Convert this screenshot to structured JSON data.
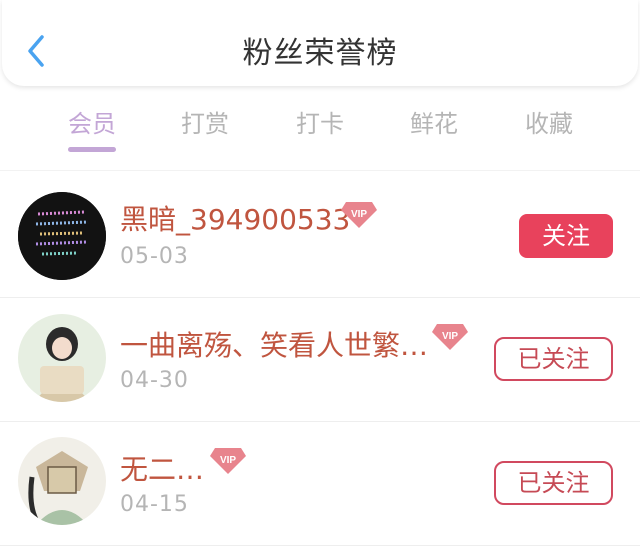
{
  "header": {
    "title": "粉丝荣誉榜",
    "back_icon": "chevron-left-icon"
  },
  "tabs": [
    {
      "label": "会员",
      "active": true
    },
    {
      "label": "打赏",
      "active": false
    },
    {
      "label": "打卡",
      "active": false
    },
    {
      "label": "鲜花",
      "active": false
    },
    {
      "label": "收藏",
      "active": false
    }
  ],
  "colors": {
    "active_tab": "#c3a6d6",
    "name": "#c0553f",
    "follow_button": "#e8425c",
    "followed_border": "#d1495f"
  },
  "fans": [
    {
      "name": "黑暗_394900533",
      "vip": "VIP",
      "date": "05-03",
      "button": "关注",
      "followed": false
    },
    {
      "name": "一曲离殇、笑看人世繁…",
      "vip": "VIP",
      "date": "04-30",
      "button": "已关注",
      "followed": true
    },
    {
      "name": "无二…",
      "vip": "VIP",
      "date": "04-15",
      "button": "已关注",
      "followed": true
    }
  ]
}
